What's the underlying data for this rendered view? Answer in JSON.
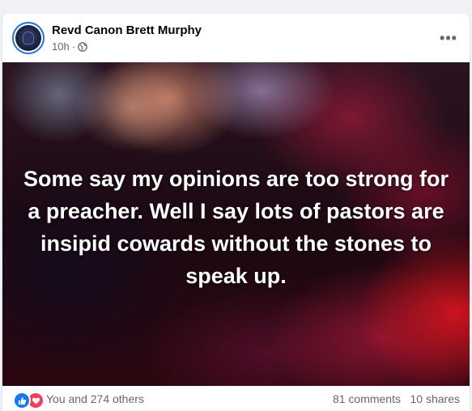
{
  "post": {
    "author": "Revd Canon Brett Murphy",
    "time": "10h",
    "separator": "·",
    "audience_icon": "globe-icon",
    "more_icon": "more-options-icon",
    "more_label": "•••",
    "text": "Some say my opinions are too strong for a preacher. Well I say lots of pastors are insipid cowards without the stones to speak up."
  },
  "footer": {
    "reaction_icons": [
      "like-icon",
      "love-icon"
    ],
    "reaction_text": "You and 274 others",
    "comments": "81 comments",
    "shares": "10 shares"
  },
  "colors": {
    "like": "#1877f2",
    "love": "#f33e58",
    "secondary_text": "#65676b",
    "primary_text": "#050505"
  }
}
